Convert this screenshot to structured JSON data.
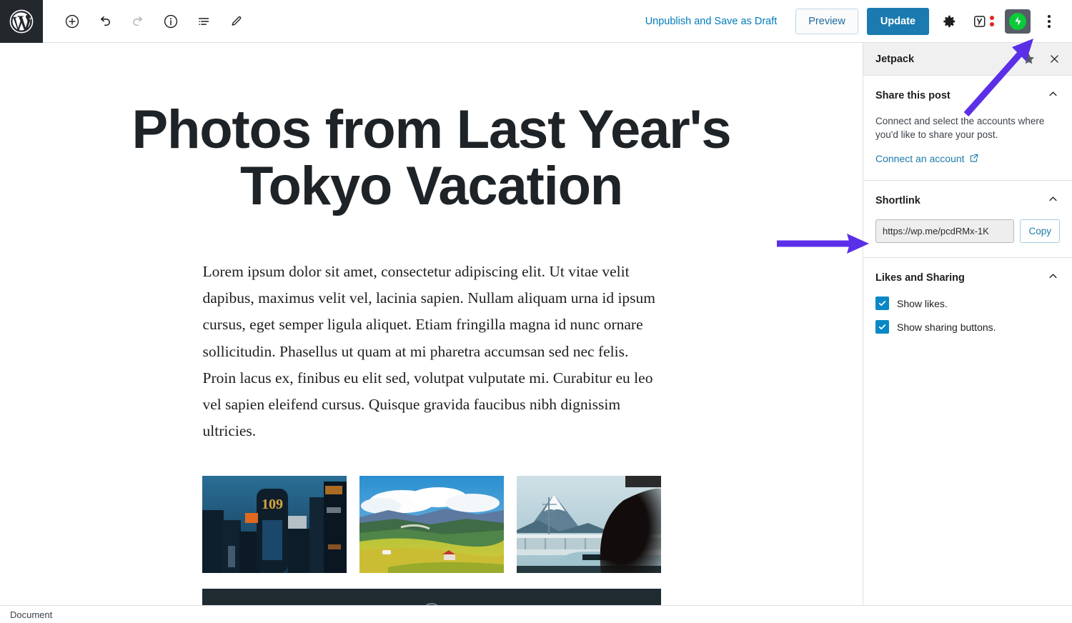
{
  "app": {
    "logo_icon": "wordpress-logo-icon",
    "status_bar_label": "Document"
  },
  "toolbar": {
    "left_tools": [
      {
        "name": "add-block-button",
        "icon": "plus-circle-icon",
        "label": "Add block",
        "disabled": false
      },
      {
        "name": "undo-button",
        "icon": "undo-icon",
        "label": "Undo",
        "disabled": false
      },
      {
        "name": "redo-button",
        "icon": "redo-icon",
        "label": "Redo",
        "disabled": true
      },
      {
        "name": "details-button",
        "icon": "info-circle-icon",
        "label": "Details",
        "disabled": false
      },
      {
        "name": "list-view-button",
        "icon": "list-view-icon",
        "label": "List view",
        "disabled": false
      },
      {
        "name": "edit-button",
        "icon": "pencil-icon",
        "label": "Edit",
        "disabled": false
      }
    ],
    "unpublish_label": "Unpublish and Save as Draft",
    "preview_label": "Preview",
    "update_label": "Update",
    "settings_icon": "gear-icon",
    "yoast_icon": "yoast-seo-icon",
    "jetpack_icon": "jetpack-bolt-icon",
    "more_icon": "kebab-menu-icon"
  },
  "editor": {
    "title": "Photos from Last Year's Tokyo Vacation",
    "paragraph": "Lorem ipsum dolor sit amet, consectetur adipiscing elit. Ut vitae velit dapibus, maximus velit vel, lacinia sapien. Nullam aliquam urna id ipsum cursus, eget semper ligula aliquet. Etiam fringilla magna id nunc ornare sollicitudin. Phasellus ut quam at mi pharetra accumsan sed nec felis. Proin lacus ex, finibus eu elit sed, volutpat vulputate mi. Curabitur eu leo vel sapien eleifend cursus. Quisque gravida faucibus nibh dignissim ultricies.",
    "gallery": [
      {
        "name": "gallery-image-shibuya-109",
        "alt": "Shibuya 109 building at dusk with neon signs"
      },
      {
        "name": "gallery-image-countryside",
        "alt": "Green rice fields and mountains under clouds"
      },
      {
        "name": "gallery-image-mount-fuji",
        "alt": "Mount Fuji seen from a moving train window"
      }
    ],
    "dark_block": {
      "name": "video-block",
      "alt": "Dark video block"
    }
  },
  "sidebar": {
    "title": "Jetpack",
    "pin_icon": "star-icon",
    "close_icon": "close-icon",
    "sections": [
      {
        "name": "share-this-post",
        "title": "Share this post",
        "chevron_icon": "chevron-up-icon",
        "description": "Connect and select the accounts where you'd like to share your post.",
        "link_label": "Connect an account",
        "link_icon": "external-link-icon"
      },
      {
        "name": "shortlink",
        "title": "Shortlink",
        "chevron_icon": "chevron-up-icon",
        "value": "https://wp.me/pcdRMx-1K",
        "copy_label": "Copy"
      },
      {
        "name": "likes-and-sharing",
        "title": "Likes and Sharing",
        "chevron_icon": "chevron-up-icon",
        "checkboxes": [
          {
            "name": "show-likes-checkbox",
            "label": "Show likes.",
            "checked": true
          },
          {
            "name": "show-sharing-buttons-checkbox",
            "label": "Show sharing buttons.",
            "checked": true
          }
        ]
      }
    ]
  },
  "annotations": {
    "color": "#5b2fe8",
    "arrows": [
      {
        "name": "annotation-arrow-jetpack-button",
        "direction": "diagonal-up-right"
      },
      {
        "name": "annotation-arrow-shortlink",
        "direction": "right"
      }
    ]
  },
  "colors": {
    "accent_blue": "#1b7bb0",
    "link_blue": "#007cba",
    "jetpack_green": "#0aca3a",
    "checkbox_blue": "#0a88c5",
    "wp_dark": "#23282d",
    "annotation_purple": "#5b2fe8"
  }
}
